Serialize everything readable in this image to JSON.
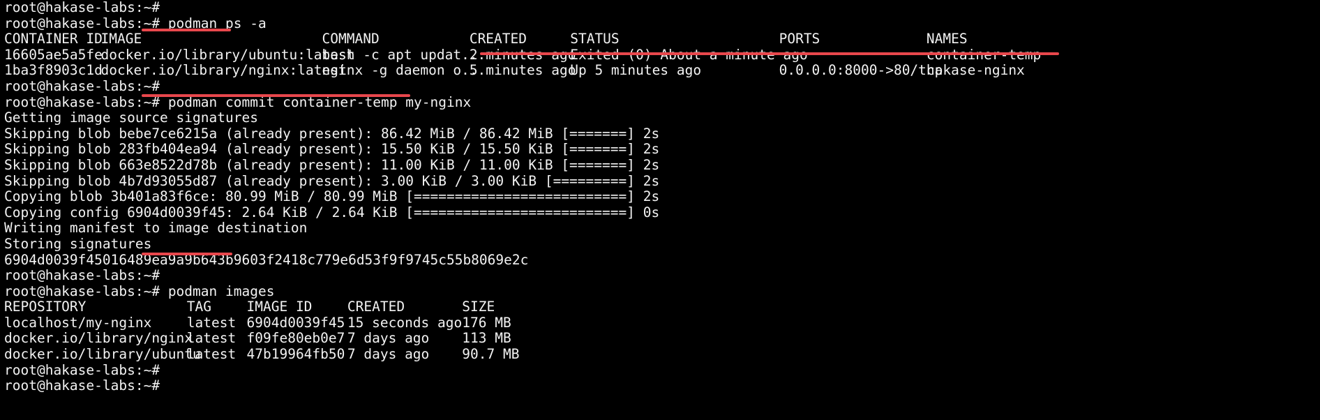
{
  "terminal": {
    "prompt": "root@hakase-labs:~#",
    "lines": [
      {
        "type": "prompt",
        "cmd": ""
      },
      {
        "type": "prompt",
        "cmd": "podman ps -a"
      },
      {
        "type": "row",
        "cells": [
          "CONTAINER ID",
          "IMAGE",
          "COMMAND",
          "CREATED",
          "STATUS",
          "PORTS",
          "NAMES"
        ]
      },
      {
        "type": "row",
        "cells": [
          "16605ae5a5fe",
          "docker.io/library/ubuntu:latest",
          "bash -c apt updat...",
          "2 minutes ago",
          "Exited (0) About a minute ago",
          "",
          "container-temp"
        ]
      },
      {
        "type": "row",
        "cells": [
          "1ba3f8903c1d",
          "docker.io/library/nginx:latest",
          "nginx -g daemon o...",
          "5 minutes ago",
          "Up 5 minutes ago",
          "0.0.0.0:8000->80/tcp",
          "hakase-nginx"
        ]
      },
      {
        "type": "prompt",
        "cmd": ""
      },
      {
        "type": "prompt",
        "cmd": "podman commit container-temp my-nginx"
      },
      {
        "type": "text",
        "text": "Getting image source signatures"
      },
      {
        "type": "text",
        "text": "Skipping blob bebe7ce6215a (already present): 86.42 MiB / 86.42 MiB [=======] 2s"
      },
      {
        "type": "text",
        "text": "Skipping blob 283fb404ea94 (already present): 15.50 KiB / 15.50 KiB [=======] 2s"
      },
      {
        "type": "text",
        "text": "Skipping blob 663e8522d78b (already present): 11.00 KiB / 11.00 KiB [=======] 2s"
      },
      {
        "type": "text",
        "text": "Skipping blob 4b7d93055d87 (already present): 3.00 KiB / 3.00 KiB [=========] 2s"
      },
      {
        "type": "text",
        "text": "Copying blob 3b401a83f6ce: 80.99 MiB / 80.99 MiB [==========================] 2s"
      },
      {
        "type": "text",
        "text": "Copying config 6904d0039f45: 2.64 KiB / 2.64 KiB [==========================] 0s"
      },
      {
        "type": "text",
        "text": "Writing manifest to image destination"
      },
      {
        "type": "text",
        "text": "Storing signatures"
      },
      {
        "type": "text",
        "text": "6904d0039f45016489ea9a9b643b9603f2418c779e6d53f9f9745c55b8069e2c"
      },
      {
        "type": "prompt",
        "cmd": ""
      },
      {
        "type": "prompt",
        "cmd": "podman images"
      },
      {
        "type": "row2",
        "cells": [
          "REPOSITORY",
          "TAG",
          "IMAGE ID",
          "CREATED",
          "SIZE"
        ]
      },
      {
        "type": "row2",
        "cells": [
          "localhost/my-nginx",
          "latest",
          "6904d0039f45",
          "15 seconds ago",
          "176 MB"
        ]
      },
      {
        "type": "row2",
        "cells": [
          "docker.io/library/nginx",
          "latest",
          "f09fe80eb0e7",
          "7 days ago",
          "113 MB"
        ]
      },
      {
        "type": "row2",
        "cells": [
          "docker.io/library/ubuntu",
          "latest",
          "47b19964fb50",
          "7 days ago",
          "90.7 MB"
        ]
      },
      {
        "type": "prompt",
        "cmd": ""
      },
      {
        "type": "prompt",
        "cmd": ""
      }
    ]
  },
  "colors": {
    "background": "#000000",
    "foreground": "#f2f2f2",
    "annotation": "#e8474c"
  }
}
